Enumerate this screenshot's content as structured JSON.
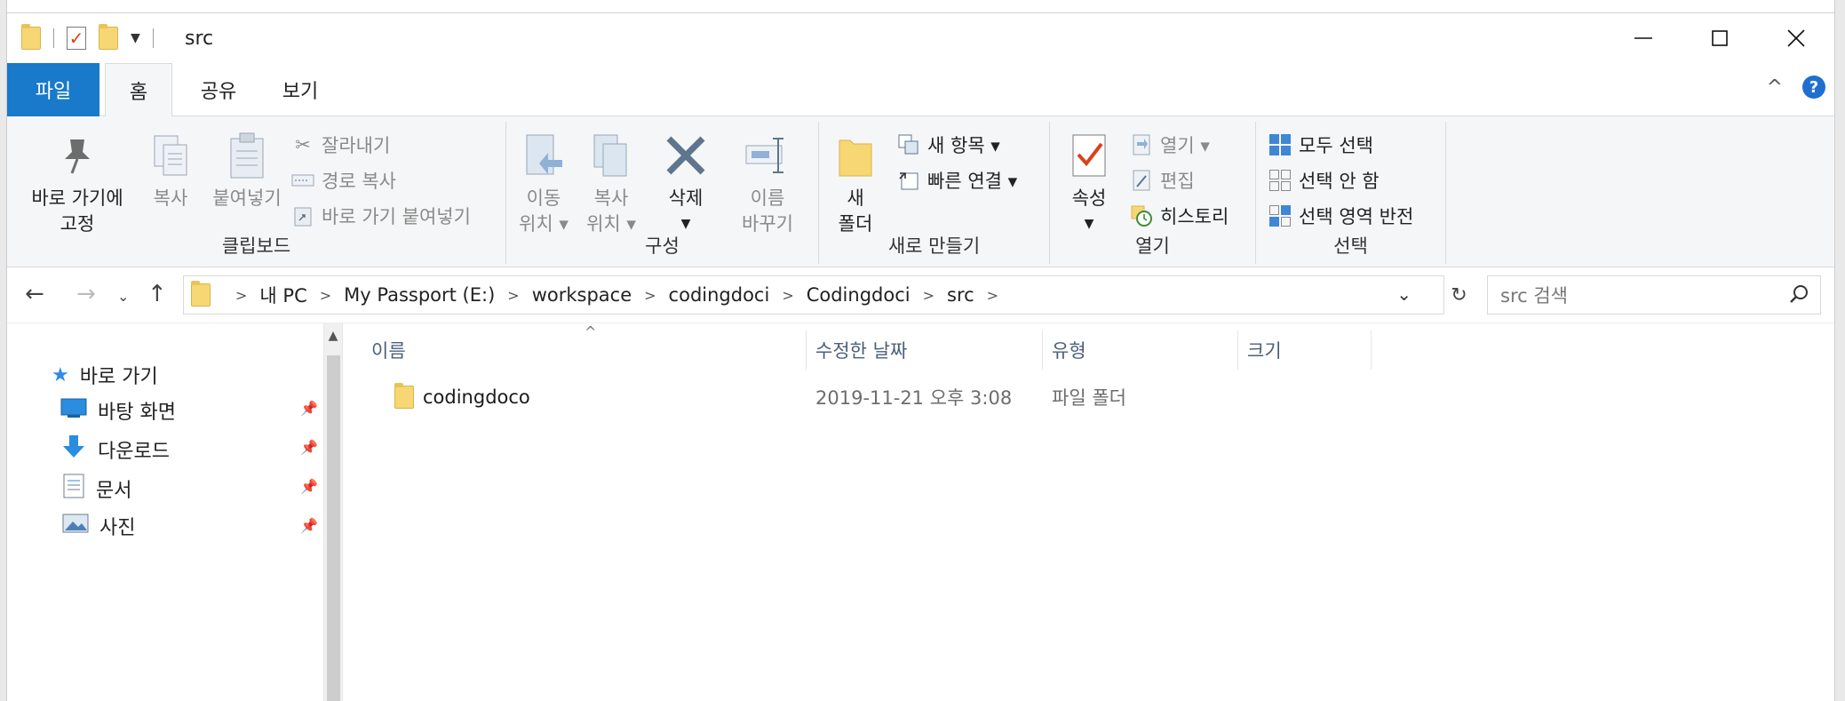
{
  "window": {
    "title": "src"
  },
  "ribbon_tabs": {
    "file": "파일",
    "home": "홈",
    "share": "공유",
    "view": "보기"
  },
  "ribbon": {
    "clipboard": {
      "label": "클립보드",
      "pin_quick_access": [
        "바로 가기에",
        "고정"
      ],
      "copy": "복사",
      "paste": "붙여넣기",
      "cut": "잘라내기",
      "copy_path": "경로 복사",
      "paste_shortcut": "바로 가기 붙여넣기"
    },
    "organize": {
      "label": "구성",
      "move_to": [
        "이동",
        "위치 ▾"
      ],
      "copy_to": [
        "복사",
        "위치 ▾"
      ],
      "delete": "삭제",
      "rename": [
        "이름",
        "바꾸기"
      ]
    },
    "new": {
      "label": "새로 만들기",
      "new_folder": [
        "새",
        "폴더"
      ],
      "new_item": "새 항목 ▾",
      "easy_access": "빠른 연결 ▾"
    },
    "open": {
      "label": "열기",
      "properties": "속성",
      "open": "열기 ▾",
      "edit": "편집",
      "history": "히스토리"
    },
    "select": {
      "label": "선택",
      "select_all": "모두 선택",
      "select_none": "선택 안 함",
      "invert_selection": "선택 영역 반전"
    }
  },
  "address": {
    "breadcrumbs": [
      "내 PC",
      "My Passport (E:)",
      "workspace",
      "codingdoci",
      "Codingdoci",
      "src"
    ],
    "search_placeholder": "src 검색"
  },
  "navpane": {
    "quick_access": "바로 가기",
    "items": [
      {
        "label": "바탕 화면"
      },
      {
        "label": "다운로드"
      },
      {
        "label": "문서"
      },
      {
        "label": "사진"
      }
    ]
  },
  "filelist": {
    "columns": [
      "이름",
      "수정한 날짜",
      "유형",
      "크기"
    ],
    "rows": [
      {
        "name": "codingdoco",
        "modified": "2019-11-21 오후 3:08",
        "type": "파일 폴더",
        "size": ""
      }
    ]
  },
  "colors": {
    "accent": "#1979ca",
    "folder": "#f6d774",
    "ribbon_bg": "#f5f6f7"
  }
}
